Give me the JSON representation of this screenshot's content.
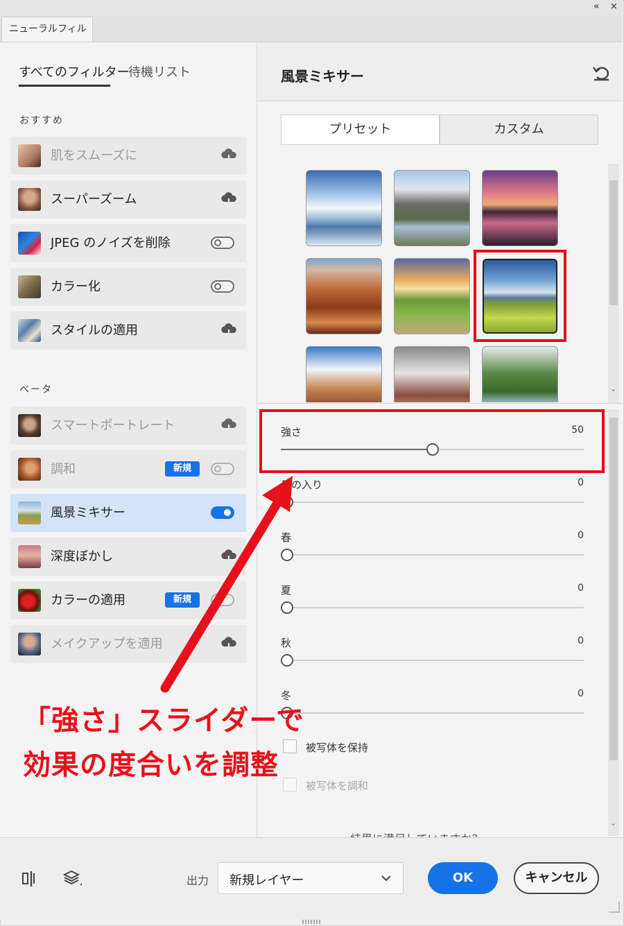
{
  "window": {
    "tab_label": "ニューラルフィルター",
    "collapse_glyph": "«",
    "close_glyph": "×"
  },
  "left_panel": {
    "tabs": [
      {
        "label": "すべてのフィルター"
      },
      {
        "label": "待機リスト"
      }
    ],
    "recommended_heading": "おすすめ",
    "beta_heading": "ベータ",
    "recommended": [
      {
        "name": "肌をスムーズに",
        "control": "cloud-download-icon",
        "dimmed": true
      },
      {
        "name": "スーパーズーム",
        "control": "cloud-download-icon",
        "dimmed": false
      },
      {
        "name": "JPEG のノイズを削除",
        "control": "toggle",
        "state": "off"
      },
      {
        "name": "カラー化",
        "control": "toggle",
        "state": "off"
      },
      {
        "name": "スタイルの適用",
        "control": "cloud-download-icon",
        "dimmed": false
      }
    ],
    "beta": [
      {
        "name": "スマートポートレート",
        "control": "cloud-download-icon",
        "dimmed": true
      },
      {
        "name": "調和",
        "badge": "新規",
        "control": "toggle",
        "state": "off"
      },
      {
        "name": "風景ミキサー",
        "control": "toggle",
        "state": "on",
        "selected": true
      },
      {
        "name": "深度ぼかし",
        "control": "cloud-download-icon"
      },
      {
        "name": "カラーの適用",
        "badge": "新規",
        "control": "toggle",
        "state": "off"
      },
      {
        "name": "メイクアップを適用",
        "control": "cloud-download-icon",
        "dimmed": true
      }
    ]
  },
  "right_panel": {
    "title": "風景ミキサー",
    "reset_icon": "undo-icon",
    "segments": [
      {
        "label": "プリセット",
        "active": true
      },
      {
        "label": "カスタム",
        "active": false
      }
    ],
    "presets": [
      {
        "name": "snow-mountain-lake"
      },
      {
        "name": "mountain-river-valley"
      },
      {
        "name": "sunset-peak-reflection"
      },
      {
        "name": "red-canyon"
      },
      {
        "name": "sunrise-green-hills"
      },
      {
        "name": "green-meadow-mountains",
        "selected": true
      },
      {
        "name": "desert-mesa"
      },
      {
        "name": "monument-valley"
      },
      {
        "name": "green-river-valley"
      }
    ],
    "sliders": [
      {
        "label": "強さ",
        "value": "50",
        "fraction": 0.5,
        "highlighted": true
      },
      {
        "label": "日の入り",
        "value": "0",
        "fraction": 0
      },
      {
        "label": "春",
        "value": "0",
        "fraction": 0
      },
      {
        "label": "夏",
        "value": "0",
        "fraction": 0
      },
      {
        "label": "秋",
        "value": "0",
        "fraction": 0
      },
      {
        "label": "冬",
        "value": "0",
        "fraction": 0
      }
    ],
    "checkboxes": [
      {
        "label": "被写体を保持",
        "checked": false,
        "enabled": true
      },
      {
        "label": "被写体を調和",
        "checked": false,
        "enabled": false
      }
    ],
    "feedback_text": "結果に満足していますか？"
  },
  "footer": {
    "output_label": "出力",
    "output_value": "新規レイヤー",
    "ok_label": "OK",
    "cancel_label": "キャンセル"
  },
  "annotation": {
    "line1": "「強さ」スライダーで",
    "line2": "効果の度合いを調整",
    "color": "#e8101a"
  },
  "colors": {
    "accent": "#1473e6",
    "highlight": "#e3101a",
    "selected_row": "#d4e4f8"
  }
}
